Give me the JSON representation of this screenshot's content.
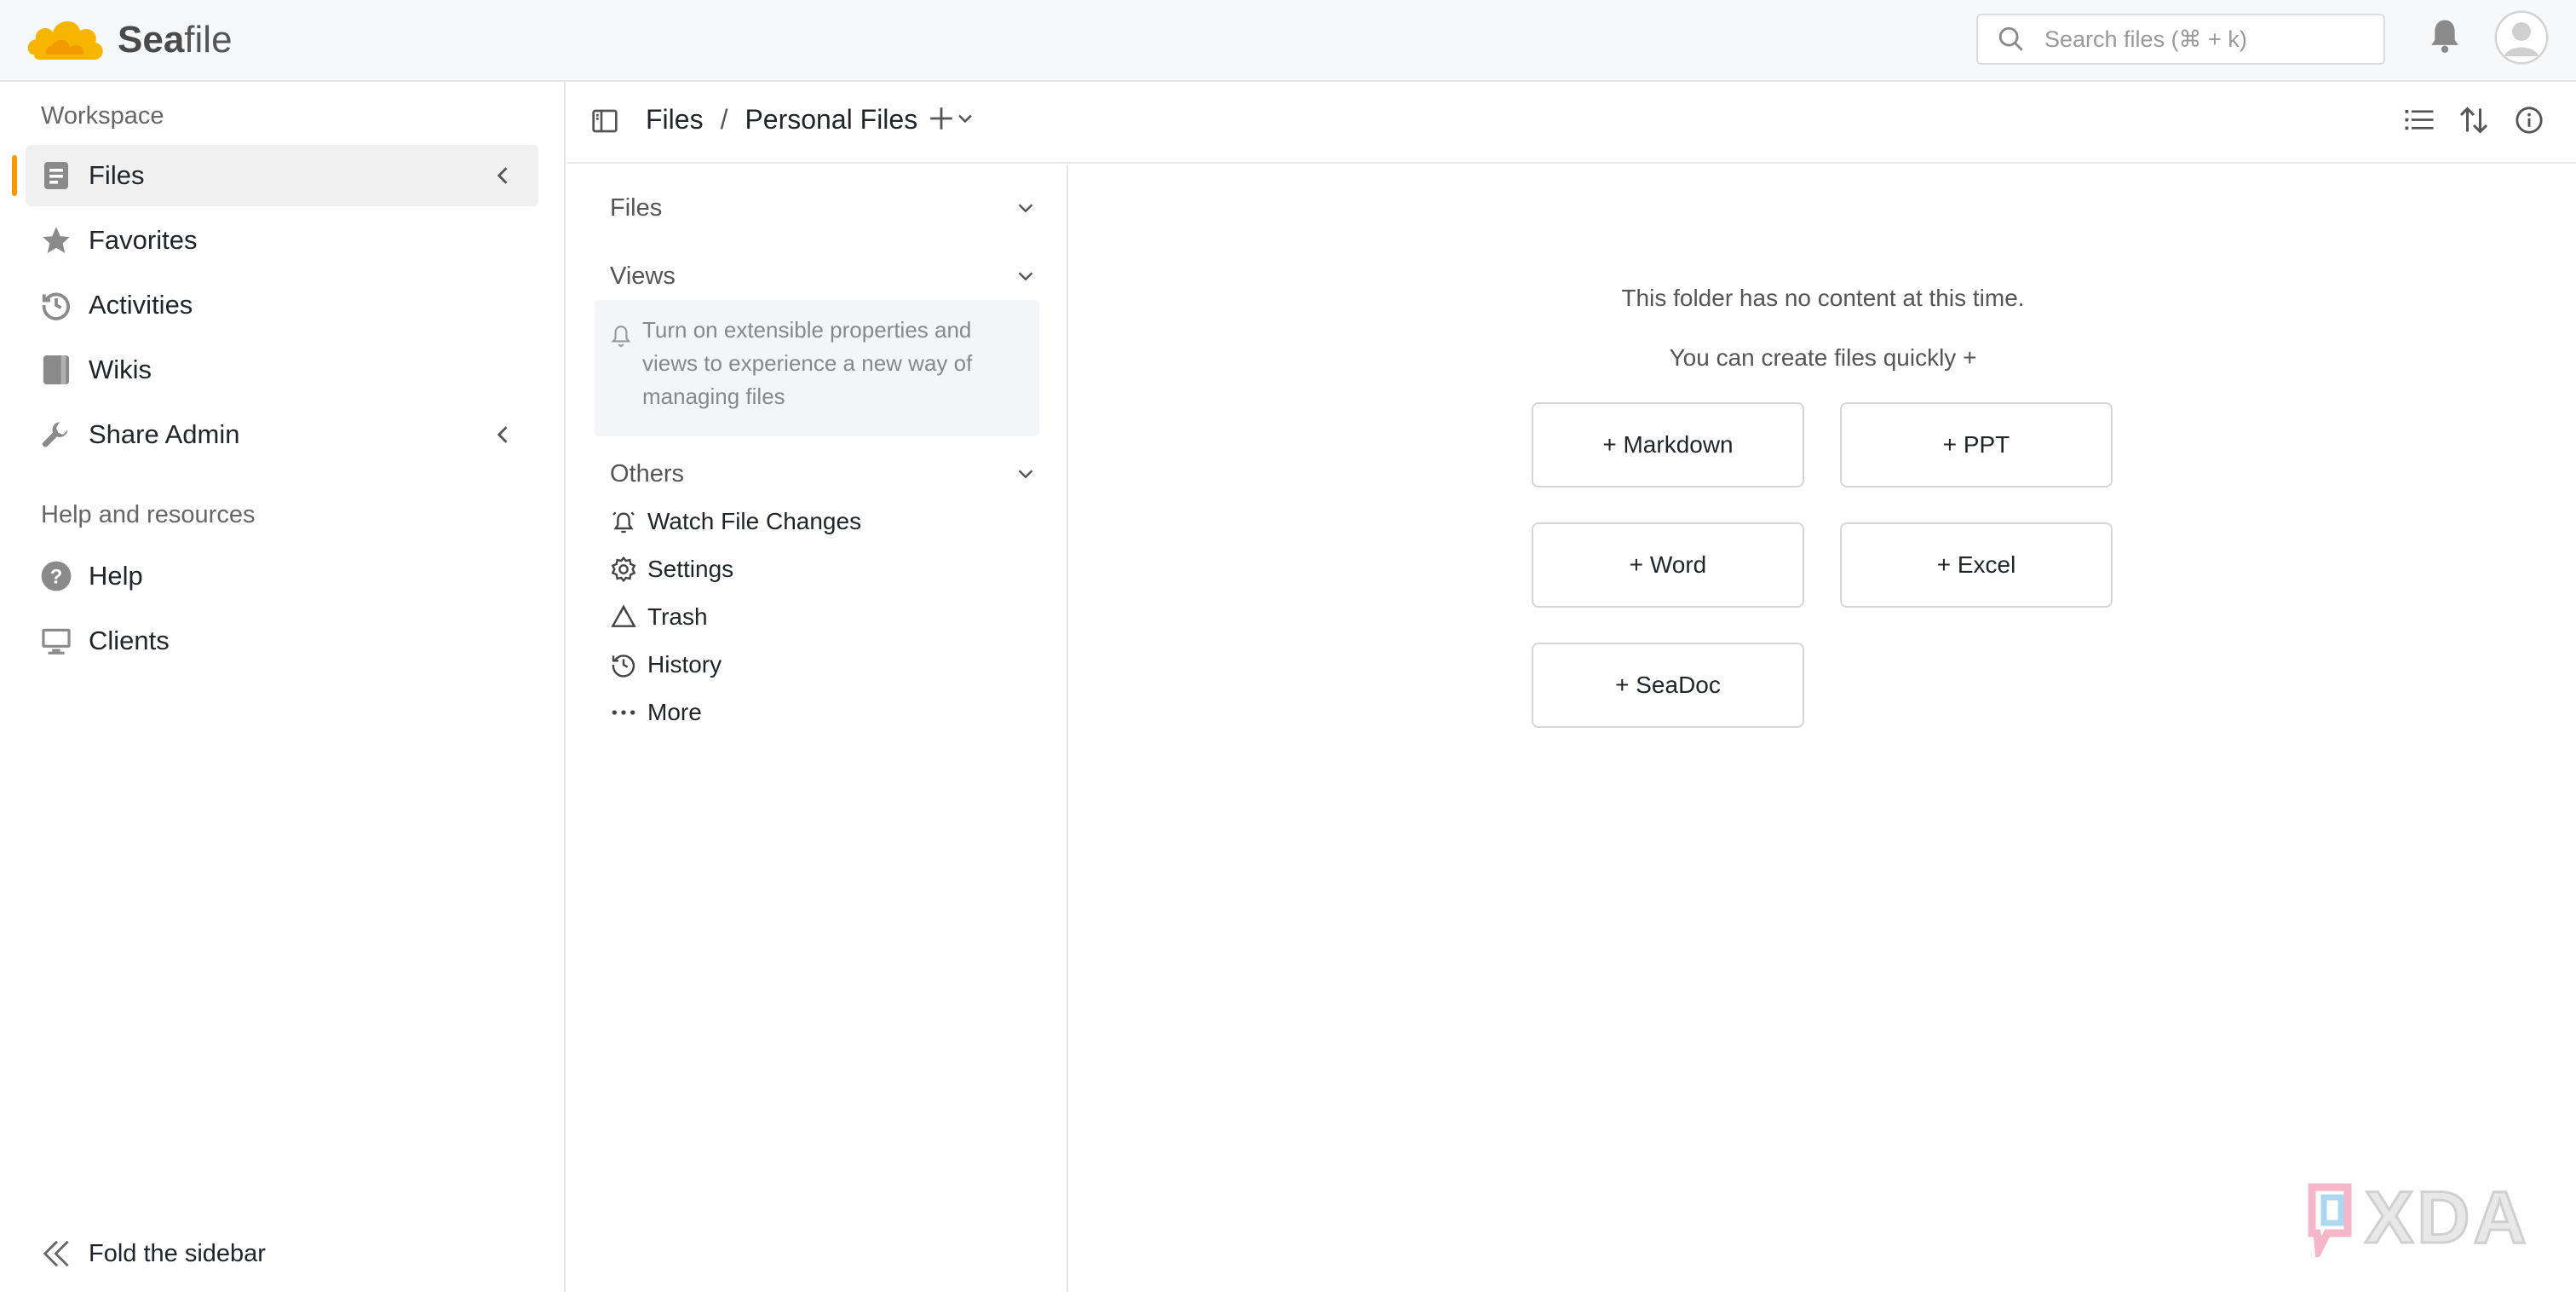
{
  "app": {
    "logo_text_bold": "Sea",
    "logo_text_rest": "file",
    "search_placeholder": "Search files (⌘ + k)"
  },
  "sidebar": {
    "workspace_title": "Workspace",
    "items": [
      {
        "label": "Files",
        "icon": "file-icon",
        "active": true,
        "has_caret": true
      },
      {
        "label": "Favorites",
        "icon": "star-icon"
      },
      {
        "label": "Activities",
        "icon": "history-icon"
      },
      {
        "label": "Wikis",
        "icon": "book-icon"
      },
      {
        "label": "Share Admin",
        "icon": "wrench-icon",
        "has_caret": true
      }
    ],
    "help_title": "Help and resources",
    "help_items": [
      {
        "label": "Help",
        "icon": "question-icon"
      },
      {
        "label": "Clients",
        "icon": "monitor-icon"
      }
    ],
    "fold_label": "Fold the sidebar"
  },
  "pathbar": {
    "crumb_root": "Files",
    "separator": "/",
    "crumb_current": "Personal Files"
  },
  "panel": {
    "files_heading": "Files",
    "views_heading": "Views",
    "views_tip": "Turn on extensible properties and views to experience a new way of managing files",
    "others_heading": "Others",
    "others_items": [
      {
        "label": "Watch File Changes",
        "icon": "alarm-icon"
      },
      {
        "label": "Settings",
        "icon": "gear-icon"
      },
      {
        "label": "Trash",
        "icon": "recycle-icon"
      },
      {
        "label": "History",
        "icon": "history-icon"
      },
      {
        "label": "More",
        "icon": "more-icon"
      }
    ]
  },
  "main": {
    "empty_message": "This folder has no content at this time.",
    "create_hint": "You can create files quickly +",
    "create_buttons": [
      "+ Markdown",
      "+ PPT",
      "+ Word",
      "+ Excel",
      "+ SeaDoc"
    ]
  },
  "watermark": {
    "text": "XDA"
  },
  "colors": {
    "accent": "#ff9800",
    "icon_gray": "#8a8a8a",
    "border": "#e6e6e6"
  }
}
